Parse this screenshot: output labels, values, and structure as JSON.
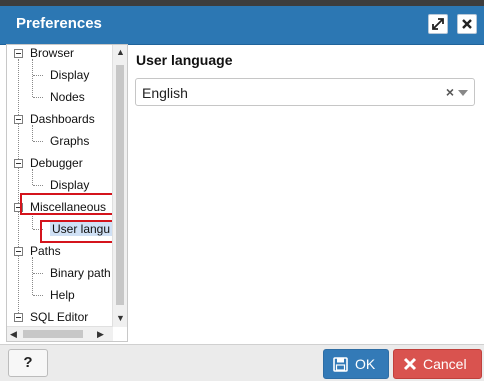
{
  "window": {
    "title": "Preferences"
  },
  "tree": {
    "groups": [
      {
        "label": "Browser",
        "children": [
          "Display",
          "Nodes"
        ]
      },
      {
        "label": "Dashboards",
        "children": [
          "Graphs"
        ]
      },
      {
        "label": "Debugger",
        "children": [
          "Display"
        ]
      },
      {
        "label": "Miscellaneous",
        "children": [
          "User langu"
        ]
      },
      {
        "label": "Paths",
        "children": [
          "Binary path",
          "Help"
        ]
      },
      {
        "label": "SQL Editor",
        "children": []
      }
    ]
  },
  "content": {
    "heading": "User language",
    "language_select": {
      "value": "English",
      "clear_symbol": "×"
    }
  },
  "footer": {
    "help_label": "?",
    "ok_label": "OK",
    "cancel_label": "Cancel"
  },
  "colors": {
    "titlebar": "#2c77b3",
    "ok": "#337ab7",
    "cancel": "#d9534f",
    "highlight_box": "#d4141c"
  }
}
